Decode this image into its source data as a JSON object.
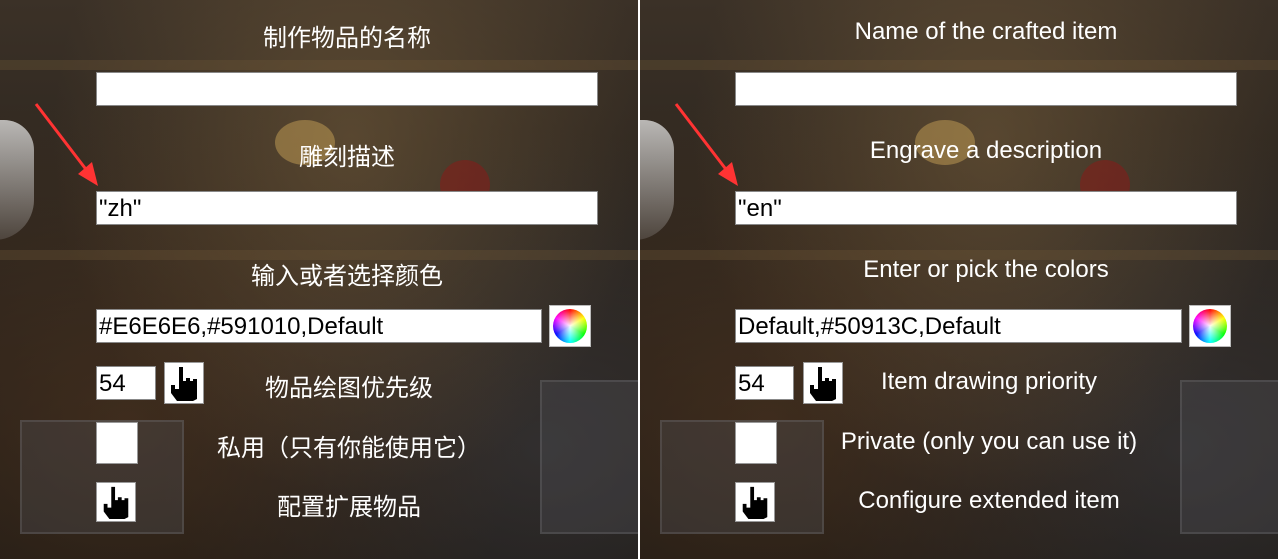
{
  "left": {
    "name_label": "制作物品的名称",
    "name_value": "",
    "description_label": "雕刻描述",
    "description_value": "\"zh\"",
    "color_label": "输入或者选择颜色",
    "color_value": "#E6E6E6,#591010,Default",
    "priority_value": "54",
    "priority_label": "物品绘图优先级",
    "private_label": "私用（只有你能使用它）",
    "configure_label": "配置扩展物品"
  },
  "right": {
    "name_label": "Name of the crafted item",
    "name_value": "",
    "description_label": "Engrave a description",
    "description_value": "\"en\"",
    "color_label": "Enter or pick the colors",
    "color_value": "Default,#50913C,Default",
    "priority_value": "54",
    "priority_label": "Item drawing priority",
    "private_label": "Private (only you can use it)",
    "configure_label": "Configure extended item"
  },
  "icons": {
    "color_picker": "color-wheel-icon",
    "pointer": "pointing-hand-icon",
    "annotation_arrow": "red-arrow-icon"
  },
  "colors": {
    "arrow": "#ff3333",
    "label_text": "#ffffff"
  }
}
